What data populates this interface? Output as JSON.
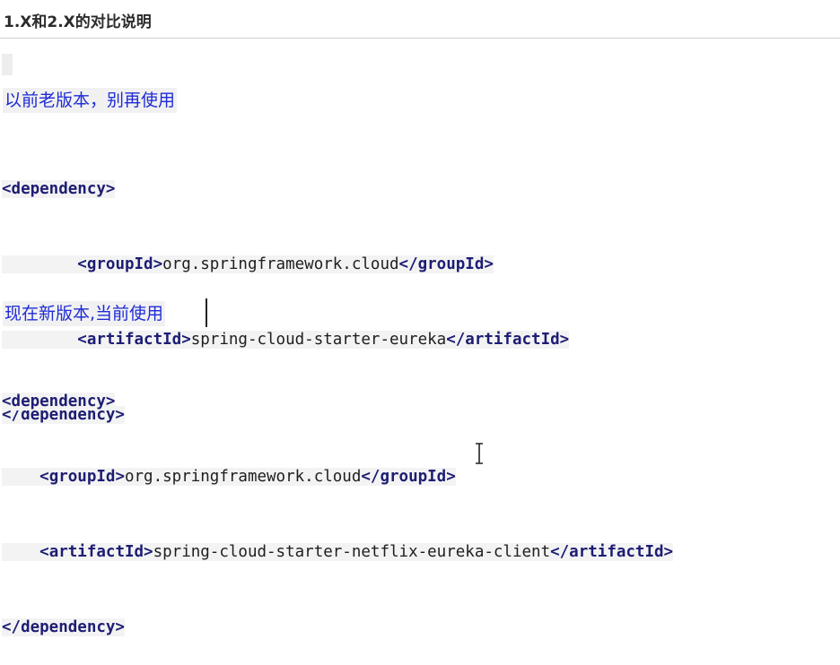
{
  "heading": "1.X和2.X的对比说明",
  "old": {
    "note": "以前老版本，别再使用",
    "lines": [
      {
        "indent": "",
        "open": "<dependency>",
        "value": "",
        "close": ""
      },
      {
        "indent": "        ",
        "open": "<groupId>",
        "value": "org.springframework.cloud",
        "close": "</groupId>"
      },
      {
        "indent": "        ",
        "open": "<artifactId>",
        "value": "spring-cloud-starter-eureka",
        "close": "</artifactId>"
      },
      {
        "indent": "",
        "open": "</dependency>",
        "value": "",
        "close": ""
      }
    ]
  },
  "new": {
    "note": "现在新版本,当前使用",
    "lines": [
      {
        "indent": "",
        "open": "<dependency>",
        "value": "",
        "close": ""
      },
      {
        "indent": "    ",
        "open": "<groupId>",
        "value": "org.springframework.cloud",
        "close": "</groupId>"
      },
      {
        "indent": "    ",
        "open": "<artifactId>",
        "value": "spring-cloud-starter-netflix-eureka-client",
        "close": "</artifactId>"
      },
      {
        "indent": "",
        "open": "</dependency>",
        "value": "",
        "close": ""
      }
    ]
  },
  "icons": {
    "text_cursor": "i-beam-cursor-icon"
  }
}
